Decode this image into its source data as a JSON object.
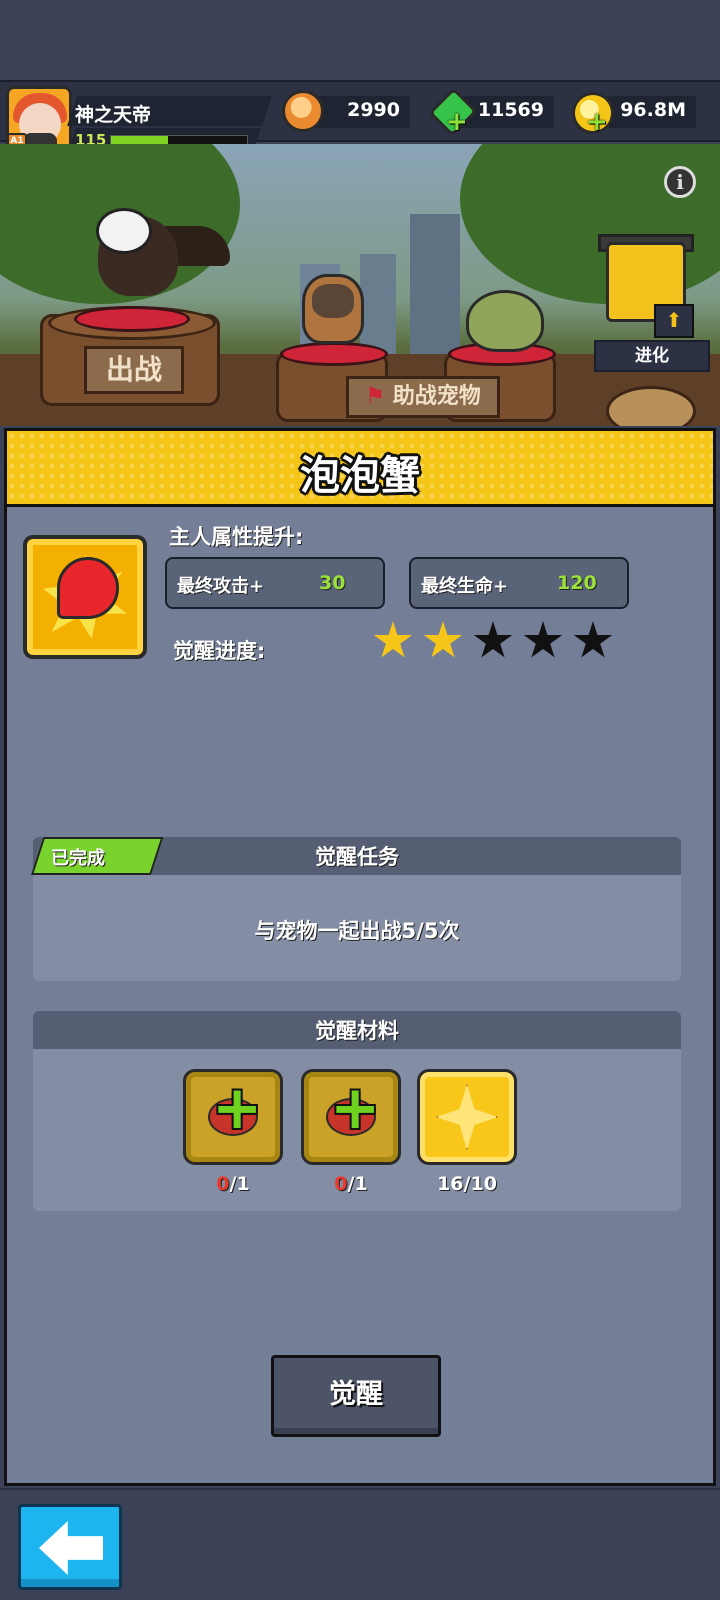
{
  "player": {
    "name": "神之天帝",
    "level": "115",
    "rank": "A1",
    "xp_fraction": 0.42
  },
  "currencies": [
    {
      "icon": "shiba-coin-icon",
      "value": "2990"
    },
    {
      "icon": "green-gem-icon",
      "value": "11569"
    },
    {
      "icon": "gold-coin-icon",
      "value": "96.8M"
    }
  ],
  "scene": {
    "deploy_sign": "出战",
    "assist_sign": "助战宠物",
    "evolve_label": "进化",
    "info_icon": "i"
  },
  "pet": {
    "name": "泡泡蟹",
    "attr_title": "主人属性提升:",
    "stats": [
      {
        "label": "最终攻击+",
        "value": "30"
      },
      {
        "label": "最终生命+",
        "value": "120"
      }
    ],
    "awaken_progress_label": "觉醒进度:",
    "stars_filled": 2,
    "stars_total": 5
  },
  "task": {
    "badge": "已完成",
    "title": "觉醒任务",
    "description": "与宠物一起出战5/5次"
  },
  "materials": {
    "title": "觉醒材料",
    "items": [
      {
        "icon": "crab-plus-icon",
        "have": "0",
        "need": "/1"
      },
      {
        "icon": "crab-plus-icon",
        "have": "0",
        "need": "/1"
      },
      {
        "icon": "gold-star-icon",
        "have": "16",
        "need": "/10"
      }
    ]
  },
  "actions": {
    "awaken_button": "觉醒"
  },
  "colors": {
    "header_yellow": "#f5c518",
    "panel_gray": "#747e96",
    "stat_green": "#9ae23a",
    "done_green": "#7ad32c",
    "back_blue": "#1eb4f0"
  }
}
